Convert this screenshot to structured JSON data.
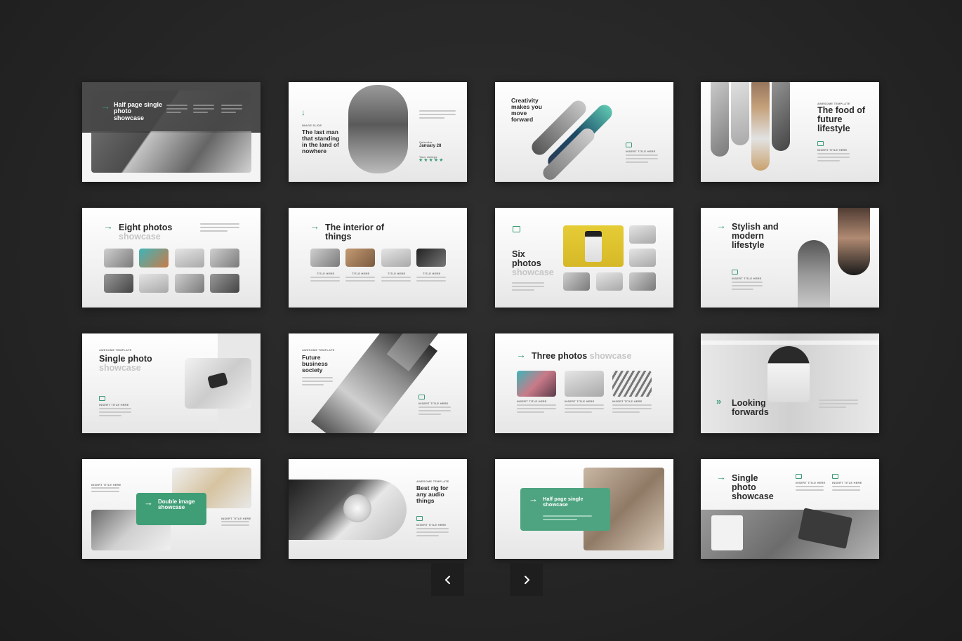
{
  "slides": [
    {
      "title": "Half page single photo showcase"
    },
    {
      "title": "The last man that standing in the land of nowhere",
      "kicker": "IMAGE SLIDE",
      "date_label": "Calendar",
      "date": "January 28",
      "rating_label": "Your ratings",
      "stars": "★★★★★"
    },
    {
      "title": "Creativity makes you move forward",
      "insert": "INSERT TITLE HERE"
    },
    {
      "title": "The food of future lifestyle",
      "kicker": "AWESOME TEMPLATE",
      "insert": "INSERT TITLE HERE"
    },
    {
      "title": "Eight photos",
      "sub": "showcase"
    },
    {
      "title": "The interior of things",
      "col_label": "TITLE HERE"
    },
    {
      "title": "Six photos",
      "sub": "showcase"
    },
    {
      "title": "Stylish and modern lifestyle",
      "insert": "INSERT TITLE HERE"
    },
    {
      "title": "Single photo",
      "sub": "showcase",
      "kicker": "AWESOME TEMPLATE",
      "insert": "INSERT TITLE HERE"
    },
    {
      "title": "Future business society",
      "kicker": "AWESOME TEMPLATE",
      "insert": "INSERT TITLE HERE"
    },
    {
      "title": "Three photos",
      "sub": "showcase",
      "col_label": "INSERT TITLE HERE"
    },
    {
      "title": "Looking forwards"
    },
    {
      "title": "Double image showcase",
      "insert": "INSERT TITLE HERE"
    },
    {
      "title": "Best rig for any audio things",
      "kicker": "AWESOME TEMPLATE",
      "insert": "INSERT TITLE HERE"
    },
    {
      "title": "Half page single showcase"
    },
    {
      "title": "Single photo showcase",
      "insert": "INSERT TITLE HERE"
    }
  ],
  "nav": {
    "prev_icon": "chevron-left-icon",
    "next_icon": "chevron-right-icon"
  },
  "colors": {
    "accent": "#3b9a74",
    "background": "#262626"
  }
}
